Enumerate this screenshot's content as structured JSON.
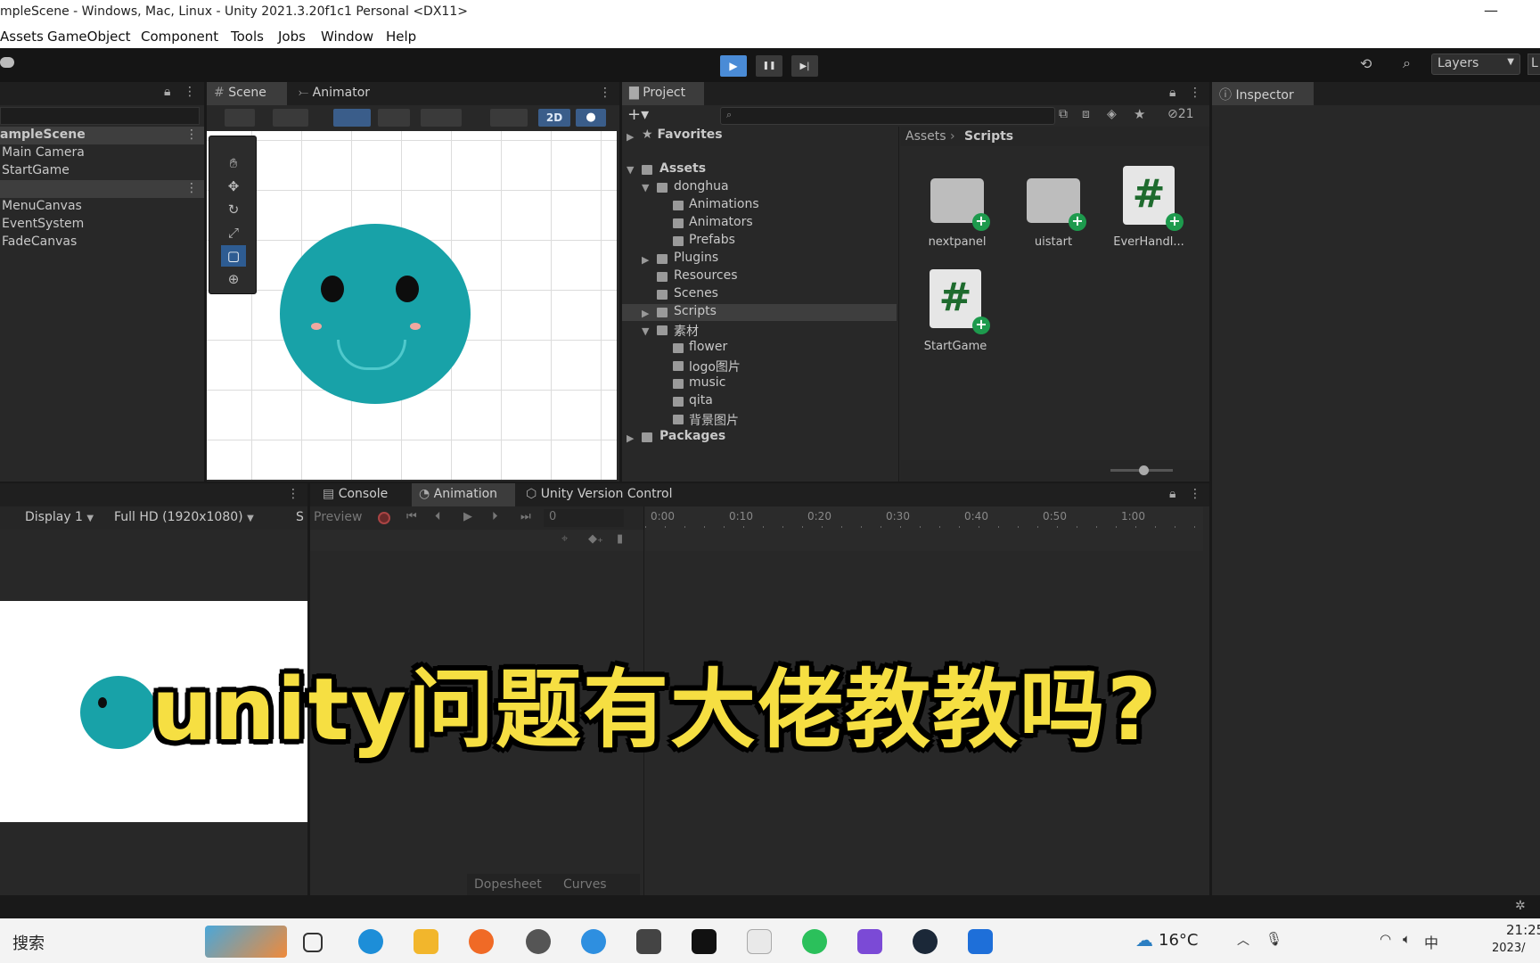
{
  "window": {
    "title": "mpleScene - Windows, Mac, Linux - Unity 2021.3.20f1c1 Personal <DX11>",
    "minimize": "—"
  },
  "menu": [
    "Assets",
    "GameObject",
    "Component",
    "Tools",
    "Jobs",
    "Window",
    "Help"
  ],
  "toolbar": {
    "play": "▶",
    "pause": "❚❚",
    "step": "▶|",
    "layers": "Layers",
    "layout": "L"
  },
  "hierarchy": {
    "items": [
      "ampleScene",
      "Main Camera",
      "StartGame",
      "MenuCanvas",
      "EventSystem",
      "FadeCanvas"
    ]
  },
  "scene": {
    "tabs": [
      "Scene",
      "Animator"
    ],
    "mode2d": "2D"
  },
  "project": {
    "tab": "Project",
    "count": "21",
    "breadcrumb": [
      "Assets",
      "Scripts"
    ],
    "tree": [
      {
        "label": "Favorites",
        "level": 0
      },
      {
        "label": "Assets",
        "level": 0
      },
      {
        "label": "donghua",
        "level": 1
      },
      {
        "label": "Animations",
        "level": 2
      },
      {
        "label": "Animators",
        "level": 2
      },
      {
        "label": "Prefabs",
        "level": 2
      },
      {
        "label": "Plugins",
        "level": 1
      },
      {
        "label": "Resources",
        "level": 1
      },
      {
        "label": "Scenes",
        "level": 1
      },
      {
        "label": "Scripts",
        "level": 1
      },
      {
        "label": "素材",
        "level": 1
      },
      {
        "label": "flower",
        "level": 2
      },
      {
        "label": "logo图片",
        "level": 2
      },
      {
        "label": "music",
        "level": 2
      },
      {
        "label": "qita",
        "level": 2
      },
      {
        "label": "背景图片",
        "level": 2
      },
      {
        "label": "Packages",
        "level": 0
      }
    ],
    "assets": [
      {
        "name": "nextpanel",
        "kind": "folder"
      },
      {
        "name": "uistart",
        "kind": "folder"
      },
      {
        "name": "EverHandl...",
        "kind": "script"
      },
      {
        "name": "StartGame",
        "kind": "script"
      }
    ]
  },
  "inspector": {
    "tab": "Inspector"
  },
  "game": {
    "display": "Display 1",
    "resolution": "Full HD (1920x1080)",
    "s": "S"
  },
  "animation": {
    "tabs": [
      "Console",
      "Animation",
      "Unity Version Control"
    ],
    "preview": "Preview",
    "frame": "0",
    "ticks": [
      "0:00",
      "0:10",
      "0:20",
      "0:30",
      "0:40",
      "0:50",
      "1:00"
    ],
    "dopesheet": "Dopesheet",
    "curves": "Curves"
  },
  "overlay": {
    "text": "unity问题有大佬教教吗?"
  },
  "taskbar": {
    "search": "搜索",
    "weather": "16°C",
    "ime": "中",
    "time": "21:25",
    "date": "2023/"
  }
}
